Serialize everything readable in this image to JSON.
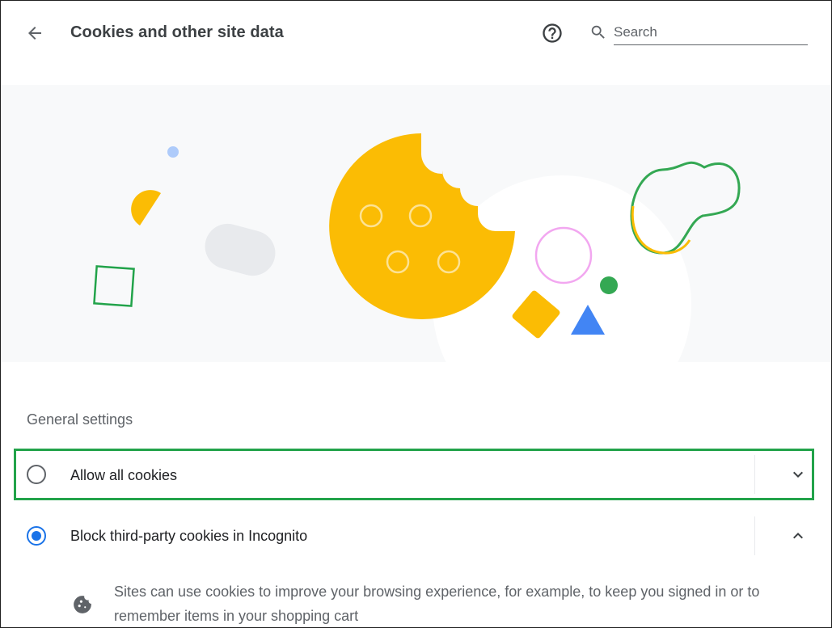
{
  "header": {
    "title": "Cookies and other site data",
    "search_placeholder": "Search"
  },
  "icons": {
    "back": "arrow-back-icon",
    "help": "help-circle-icon",
    "search": "search-icon",
    "expand": "chevron-down-icon",
    "collapse": "chevron-up-icon",
    "cookie": "cookie-icon"
  },
  "section": {
    "label": "General settings"
  },
  "options": [
    {
      "label": "Allow all cookies",
      "selected": false,
      "expanded": false
    },
    {
      "label": "Block third-party cookies in Incognito",
      "selected": true,
      "expanded": true
    }
  ],
  "details": {
    "description": "Sites can use cookies to improve your browsing experience, for example, to keep you signed in or to remember items in your shopping cart"
  },
  "colors": {
    "accent": "#1a73e8",
    "highlight_border": "#22a34a",
    "cookie_yellow": "#fbbc04",
    "hero_bg": "#f8f9fa"
  }
}
